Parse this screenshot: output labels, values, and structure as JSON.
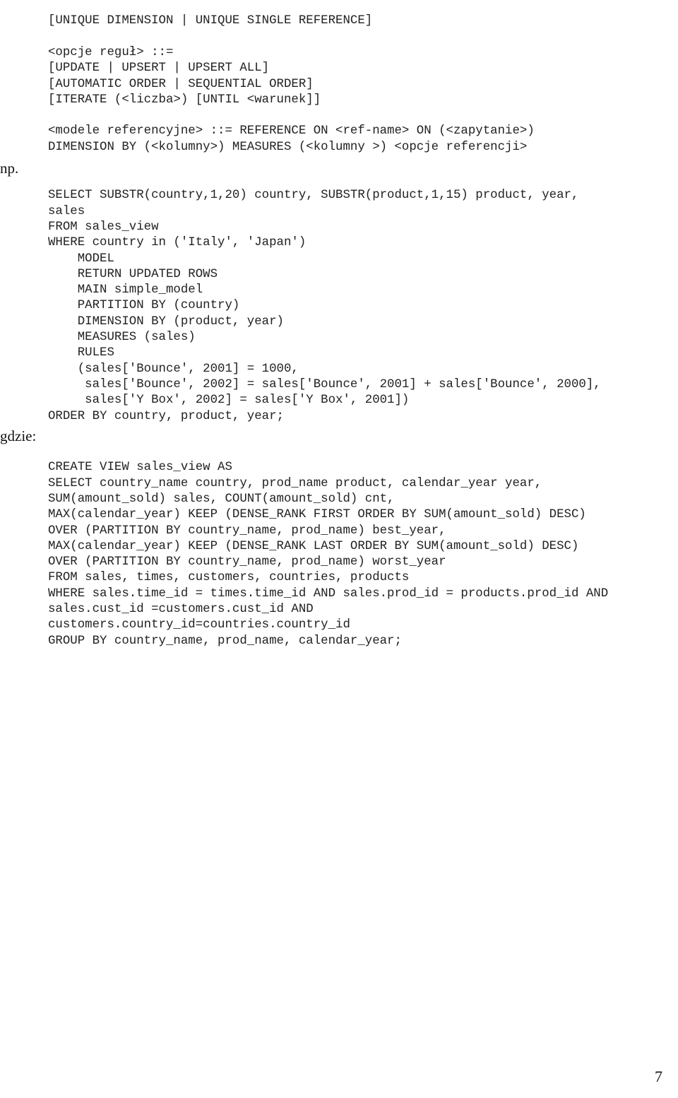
{
  "document": {
    "page_number": "7",
    "margin_labels": {
      "example": "np.",
      "where": "gdzie:"
    }
  },
  "grammar_block": {
    "name": "model-grammar",
    "lines": [
      "[UNIQUE DIMENSION | UNIQUE SINGLE REFERENCE]",
      "",
      "<opcje reguł> ::=",
      "[UPDATE | UPSERT | UPSERT ALL]",
      "[AUTOMATIC ORDER | SEQUENTIAL ORDER]",
      "[ITERATE (<liczba>) [UNTIL <warunek]]",
      "",
      "<modele referencyjne> ::= REFERENCE ON <ref-name> ON (<zapytanie>)",
      "DIMENSION BY (<kolumny>) MEASURES (<kolumny >) <opcje referencji>"
    ]
  },
  "query_block": {
    "name": "model-select-example",
    "lines": [
      "SELECT SUBSTR(country,1,20) country, SUBSTR(product,1,15) product, year,",
      "sales",
      "FROM sales_view",
      "WHERE country in ('Italy', 'Japan')",
      "    MODEL",
      "    RETURN UPDATED ROWS",
      "    MAIN simple_model",
      "    PARTITION BY (country)",
      "    DIMENSION BY (product, year)",
      "    MEASURES (sales)",
      "    RULES",
      "    (sales['Bounce', 2001] = 1000,",
      "     sales['Bounce', 2002] = sales['Bounce', 2001] + sales['Bounce', 2000],",
      "     sales['Y Box', 2002] = sales['Y Box', 2001])",
      "ORDER BY country, product, year;"
    ]
  },
  "view_block": {
    "name": "create-view-sales-view",
    "lines": [
      "CREATE VIEW sales_view AS",
      "SELECT country_name country, prod_name product, calendar_year year,",
      "SUM(amount_sold) sales, COUNT(amount_sold) cnt,",
      "MAX(calendar_year) KEEP (DENSE_RANK FIRST ORDER BY SUM(amount_sold) DESC)",
      "OVER (PARTITION BY country_name, prod_name) best_year,",
      "MAX(calendar_year) KEEP (DENSE_RANK LAST ORDER BY SUM(amount_sold) DESC)",
      "OVER (PARTITION BY country_name, prod_name) worst_year",
      "FROM sales, times, customers, countries, products",
      "WHERE sales.time_id = times.time_id AND sales.prod_id = products.prod_id AND",
      "sales.cust_id =customers.cust_id AND",
      "customers.country_id=countries.country_id",
      "GROUP BY country_name, prod_name, calendar_year;"
    ]
  }
}
